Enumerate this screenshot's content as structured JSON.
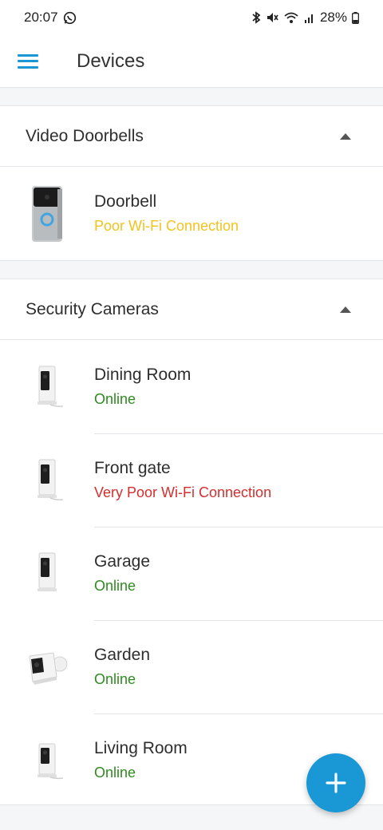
{
  "status_bar": {
    "time": "20:07",
    "battery": "28%",
    "icons": [
      "whatsapp-icon",
      "bluetooth-icon",
      "mute-icon",
      "wifi-icon",
      "signal-icon",
      "battery-icon"
    ]
  },
  "header": {
    "title": "Devices",
    "menu_icon": "hamburger-icon",
    "accent_color": "#1998d5"
  },
  "sections": [
    {
      "title": "Video Doorbells",
      "expanded": true,
      "devices": [
        {
          "name": "Doorbell",
          "status": "Poor Wi-Fi Connection",
          "status_color": "#f2c320",
          "icon": "doorbell-icon"
        }
      ]
    },
    {
      "title": "Security Cameras",
      "expanded": true,
      "devices": [
        {
          "name": "Dining Room",
          "status": "Online",
          "status_color": "#2e8b1f",
          "icon": "indoor-camera-icon"
        },
        {
          "name": "Front gate",
          "status": "Very Poor Wi-Fi Connection",
          "status_color": "#d32f2f",
          "icon": "indoor-camera-icon"
        },
        {
          "name": "Garage",
          "status": "Online",
          "status_color": "#2e8b1f",
          "icon": "indoor-camera-icon"
        },
        {
          "name": "Garden",
          "status": "Online",
          "status_color": "#2e8b1f",
          "icon": "spotlight-camera-icon"
        },
        {
          "name": "Living Room",
          "status": "Online",
          "status_color": "#2e8b1f",
          "icon": "indoor-camera-icon"
        }
      ]
    }
  ],
  "fab": {
    "icon": "plus-icon"
  }
}
